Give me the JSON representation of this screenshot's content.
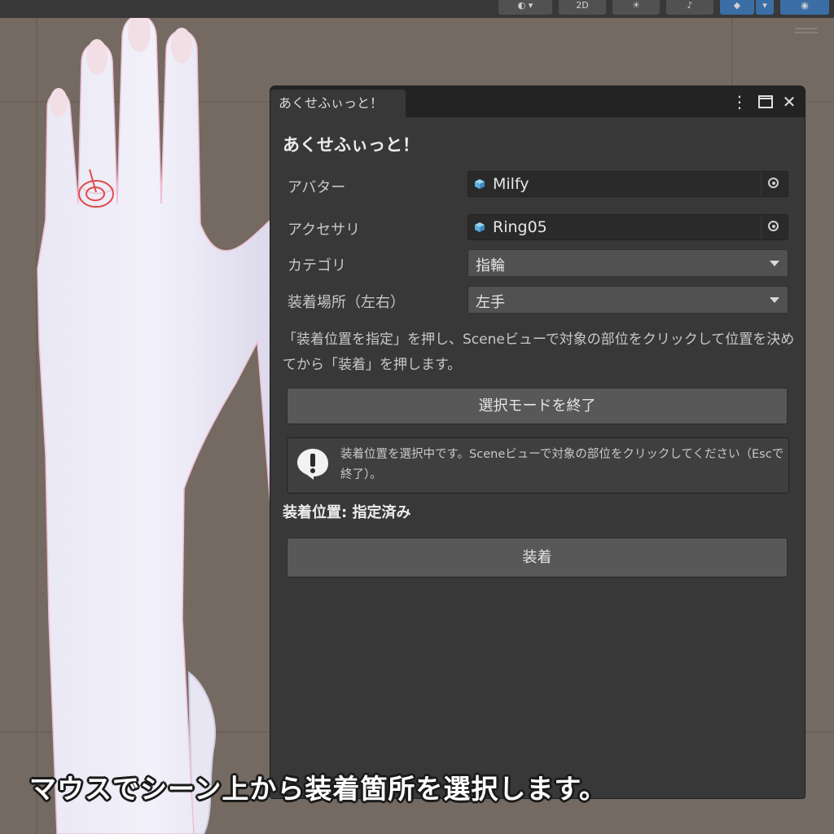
{
  "toolbar": {
    "mode_2d_label": "2D"
  },
  "window": {
    "tab_title": "あくせふぃっと！",
    "menu_icon": "vertical-dots-icon",
    "maximize_icon": "maximize-icon",
    "close_icon": "close-icon",
    "heading": "あくせふぃっと！",
    "fields": {
      "avatar": {
        "label": "アバター",
        "value": "Milfy",
        "icon": "prefab-cube-icon"
      },
      "accessory": {
        "label": "アクセサリ",
        "value": "Ring05",
        "icon": "prefab-cube-icon"
      },
      "category": {
        "label": "カテゴリ",
        "value": "指輪"
      },
      "side": {
        "label": "装着場所（左右）",
        "value": "左手"
      }
    },
    "instructions": "「装着位置を指定」を押し、Sceneビューで対象の部位をクリックして位置を決めてから「装着」を押します。",
    "end_select_button": "選択モードを終了",
    "help_message": "装着位置を選択中です。Sceneビューで対象の部位をクリックしてください（Escで終了）。",
    "status": "装着位置: 指定済み",
    "attach_button": "装着"
  },
  "caption": "マウスでシーン上から装着箇所を選択します。",
  "colors": {
    "scene_bg": "#746a62",
    "panel_bg": "#383838",
    "accent": "#3a6ea5",
    "gizmo": "#e04a4a"
  }
}
